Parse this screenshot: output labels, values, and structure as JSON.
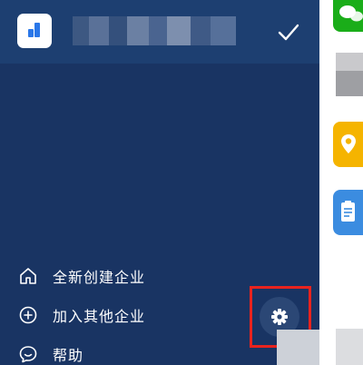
{
  "header": {
    "org_logo_icon": "org-logo-icon",
    "org_name_redacted": true,
    "check_icon": "check-icon"
  },
  "menu": {
    "items": [
      {
        "label": "全新创建企业",
        "icon": "home-icon"
      },
      {
        "label": "加入其他企业",
        "icon": "plus-circle-icon"
      },
      {
        "label": "帮助",
        "icon": "chat-bubble-icon"
      }
    ]
  },
  "settings": {
    "icon": "gear-icon"
  },
  "colors": {
    "drawer_bg": "#193463",
    "header_bg": "#1d3f71",
    "highlight": "#e8231e",
    "wechat_green": "#1aad19",
    "map_yellow": "#f5b400",
    "clipboard_blue": "#3b8ce0"
  },
  "right_strip": {
    "apps": [
      "wechat-icon",
      "location-pin-icon",
      "clipboard-icon"
    ]
  }
}
